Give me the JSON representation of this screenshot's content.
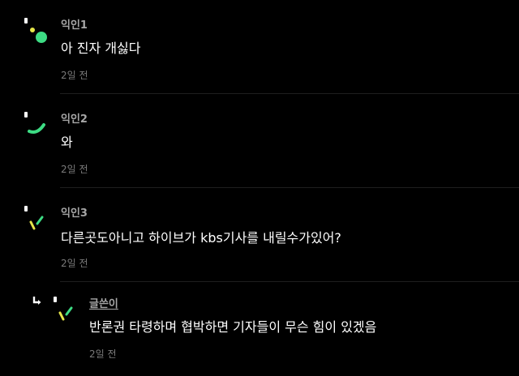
{
  "colors": {
    "background": "#000000",
    "author": "#a6a6a6",
    "body": "#ffffff",
    "time": "#7a7a7a",
    "divider": "#1e1e1e",
    "avatar_green": "#3ddc84",
    "avatar_yellow": "#e6e64a",
    "avatar_white": "#ffffff"
  },
  "comments": [
    {
      "author": "익인1",
      "text": "아 진자 개싫다",
      "time": "2일 전",
      "avatar_icon": "dots-avatar-icon"
    },
    {
      "author": "익인2",
      "text": "와",
      "time": "2일 전",
      "avatar_icon": "arc-avatar-icon"
    },
    {
      "author": "익인3",
      "text": "다른곳도아니고 하이브가 kbs기사를 내릴수가있어?",
      "time": "2일 전",
      "avatar_icon": "slash-avatar-icon"
    }
  ],
  "reply": {
    "author": "글쓴이",
    "text": "반론권 타령하며 협박하면 기자들이 무슨 힘이 있겠음",
    "time": "2일 전",
    "reply_icon": "reply-arrow-icon",
    "avatar_icon": "slash-avatar-icon"
  }
}
